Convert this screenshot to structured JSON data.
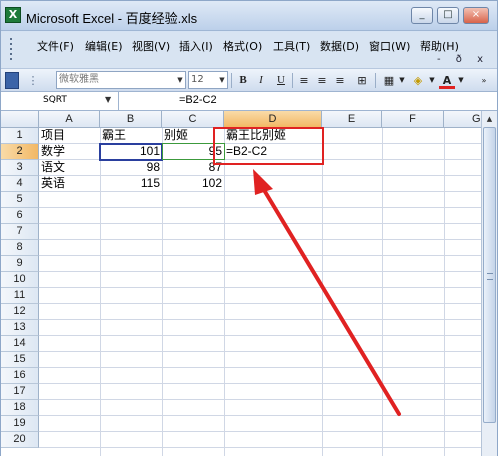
{
  "window": {
    "title": "Microsoft Excel - 百度经验.xls",
    "controls": [
      "_",
      "□",
      "×"
    ]
  },
  "menu": {
    "items": [
      "文件(F)",
      "编辑(E)",
      "视图(V)",
      "插入(I)",
      "格式(O)",
      "工具(T)",
      "数据(D)",
      "窗口(W)",
      "帮助(H)"
    ],
    "mdi_controls": "- ð x"
  },
  "toolbar": {
    "font": "微软雅黑",
    "size": "12",
    "bold": "B",
    "italic": "I",
    "underline": "U",
    "font_color_label": "A"
  },
  "formula_bar": {
    "name_box": "SQRT",
    "formula": "=B2-C2"
  },
  "sheet": {
    "columns": [
      "A",
      "B",
      "C",
      "D",
      "E",
      "F",
      "G"
    ],
    "selected_column": "D",
    "selected_row": 2,
    "rows": [
      "1",
      "2",
      "3",
      "4",
      "5",
      "6",
      "7",
      "8",
      "9",
      "10",
      "11",
      "12",
      "13",
      "14",
      "15",
      "16",
      "17",
      "18",
      "19",
      "20"
    ],
    "cells": {
      "A1": "项目",
      "B1": "霸王",
      "C1": "别姬",
      "D1": "霸王比别姬",
      "A2": "数学",
      "B2": "101",
      "C2": "95",
      "D2": "=B2-C2",
      "A3": "语文",
      "B3": "98",
      "C3": "87",
      "A4": "英语",
      "B4": "115",
      "C4": "102"
    }
  },
  "annotation": {
    "box_color": "#e02222",
    "arrow_color": "#e02222"
  }
}
